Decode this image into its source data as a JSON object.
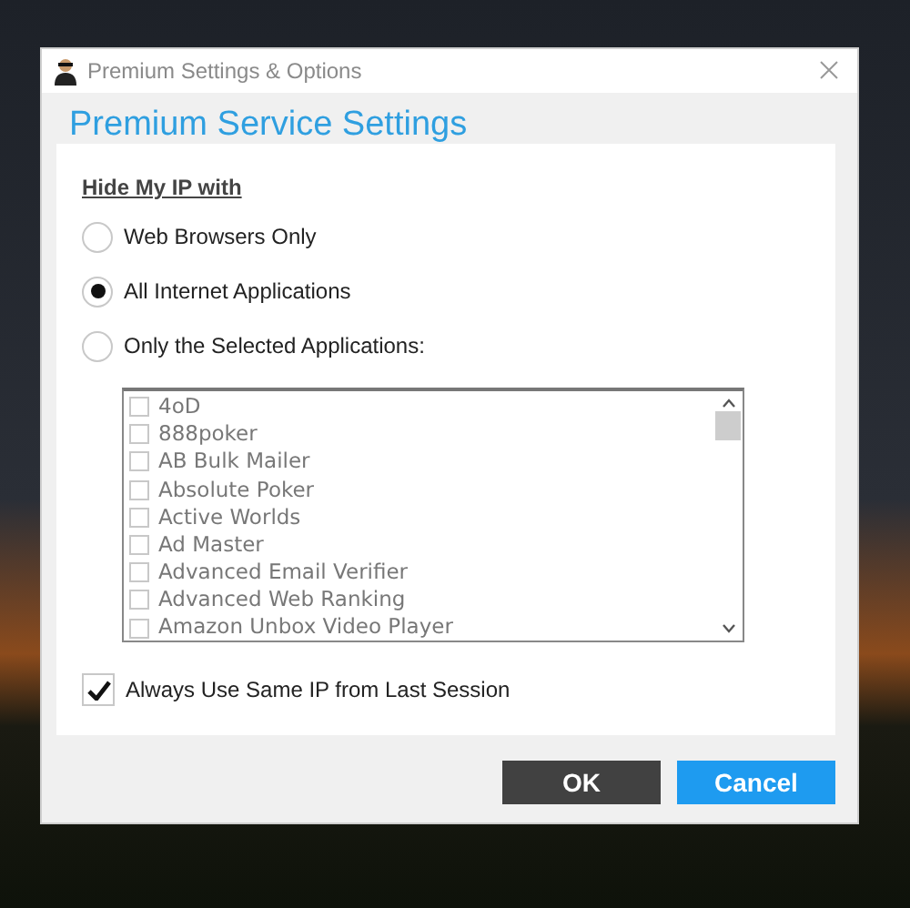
{
  "window": {
    "title": "Premium Settings & Options"
  },
  "heading": "Premium Service Settings",
  "section_label": "Hide My IP with",
  "options": [
    {
      "label": "Web Browsers Only",
      "selected": false
    },
    {
      "label": "All Internet Applications",
      "selected": true
    },
    {
      "label": "Only the Selected Applications:",
      "selected": false
    }
  ],
  "applications": [
    {
      "label": "4oD",
      "checked": false
    },
    {
      "label": "888poker",
      "checked": false
    },
    {
      "label": "AB Bulk Mailer",
      "checked": false
    },
    {
      "label": "Absolute Poker",
      "checked": false
    },
    {
      "label": "Active Worlds",
      "checked": false
    },
    {
      "label": "Ad Master",
      "checked": false
    },
    {
      "label": "Advanced Email Verifier",
      "checked": false
    },
    {
      "label": "Advanced Web Ranking",
      "checked": false
    },
    {
      "label": "Amazon Unbox Video Player",
      "checked": false
    }
  ],
  "same_ip": {
    "label": "Always Use Same IP from Last Session",
    "checked": true
  },
  "buttons": [
    {
      "label": "OK",
      "kind": "primary"
    },
    {
      "label": "Cancel",
      "kind": "secondary"
    }
  ]
}
